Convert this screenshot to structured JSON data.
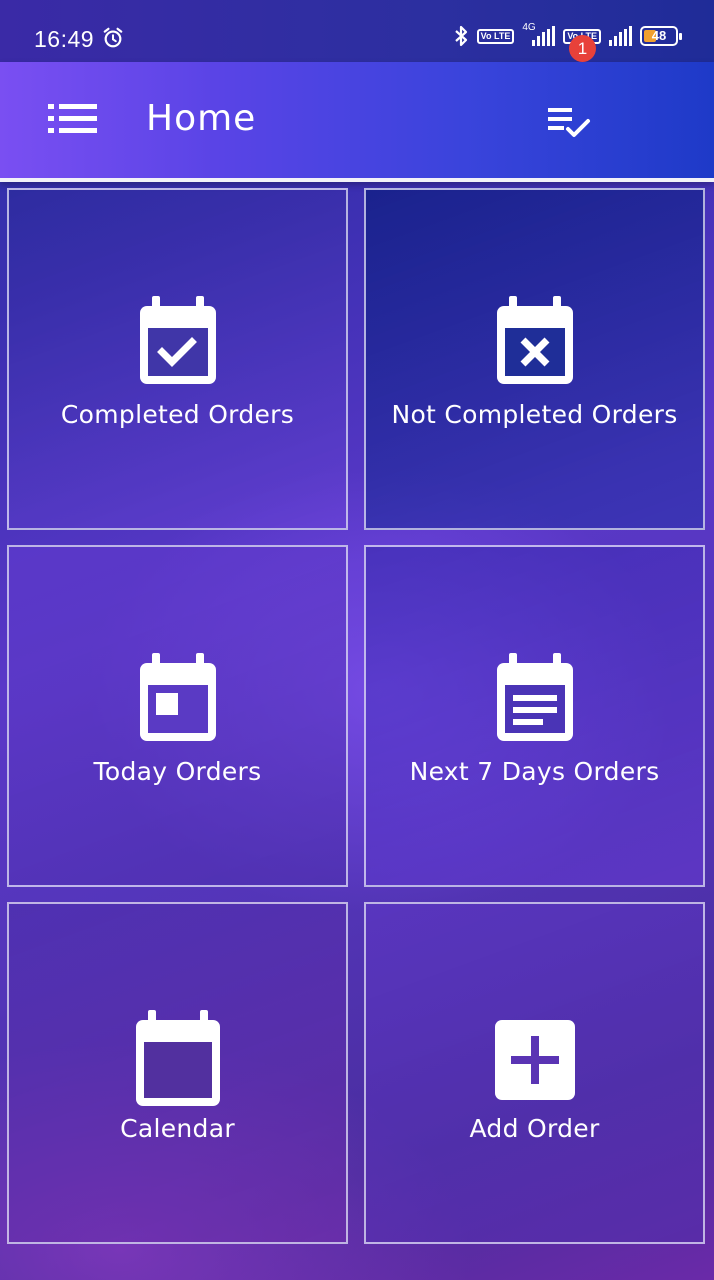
{
  "status_bar": {
    "time": "16:49",
    "icons": [
      "alarm-icon",
      "bluetooth-icon",
      "volte-icon",
      "signal-icon",
      "volte-icon",
      "signal-icon",
      "battery-icon"
    ],
    "network_label": "4G",
    "volte_label": "Vo LTE",
    "battery": "48"
  },
  "app_bar": {
    "title": "Home",
    "menu_icon": "list-icon",
    "tasks_icon": "checklist-icon",
    "notification_count": "1",
    "colors": {
      "start": "#7a4ff2",
      "end": "#1e3ac8"
    }
  },
  "tiles": [
    {
      "label": "Completed Orders",
      "icon": "calendar-check-icon"
    },
    {
      "label": "Not Completed Orders",
      "icon": "calendar-remove-icon"
    },
    {
      "label": "Today Orders",
      "icon": "calendar-today-icon"
    },
    {
      "label": "Next 7 Days Orders",
      "icon": "calendar-text-icon"
    },
    {
      "label": "Calendar",
      "icon": "calendar-blank-icon"
    },
    {
      "label": "Add Order",
      "icon": "plus-box-icon"
    }
  ],
  "badge_color": "#e8413a",
  "battery_fill": 0.48
}
